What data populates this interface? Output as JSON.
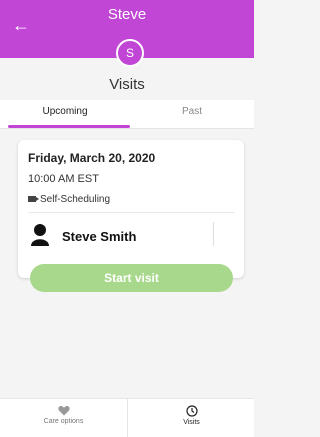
{
  "header": {
    "title": "Steve",
    "avatar_letter": "S",
    "back_icon": "arrow-left-icon"
  },
  "page": {
    "title": "Visits"
  },
  "tabs": [
    {
      "label": "Upcoming",
      "active": true
    },
    {
      "label": "Past",
      "active": false
    }
  ],
  "visit": {
    "date": "Friday, March 20, 2020",
    "time": "10:00 AM EST",
    "scheduling": "Self-Scheduling",
    "provider": "Steve Smith",
    "button_label": "Start visit"
  },
  "bottom_nav": [
    {
      "label": "Care options",
      "icon": "heart-icon"
    },
    {
      "label": "Visits",
      "icon": "clock-icon"
    }
  ],
  "colors": {
    "primary": "#c246d6",
    "button": "#a8d88b"
  }
}
